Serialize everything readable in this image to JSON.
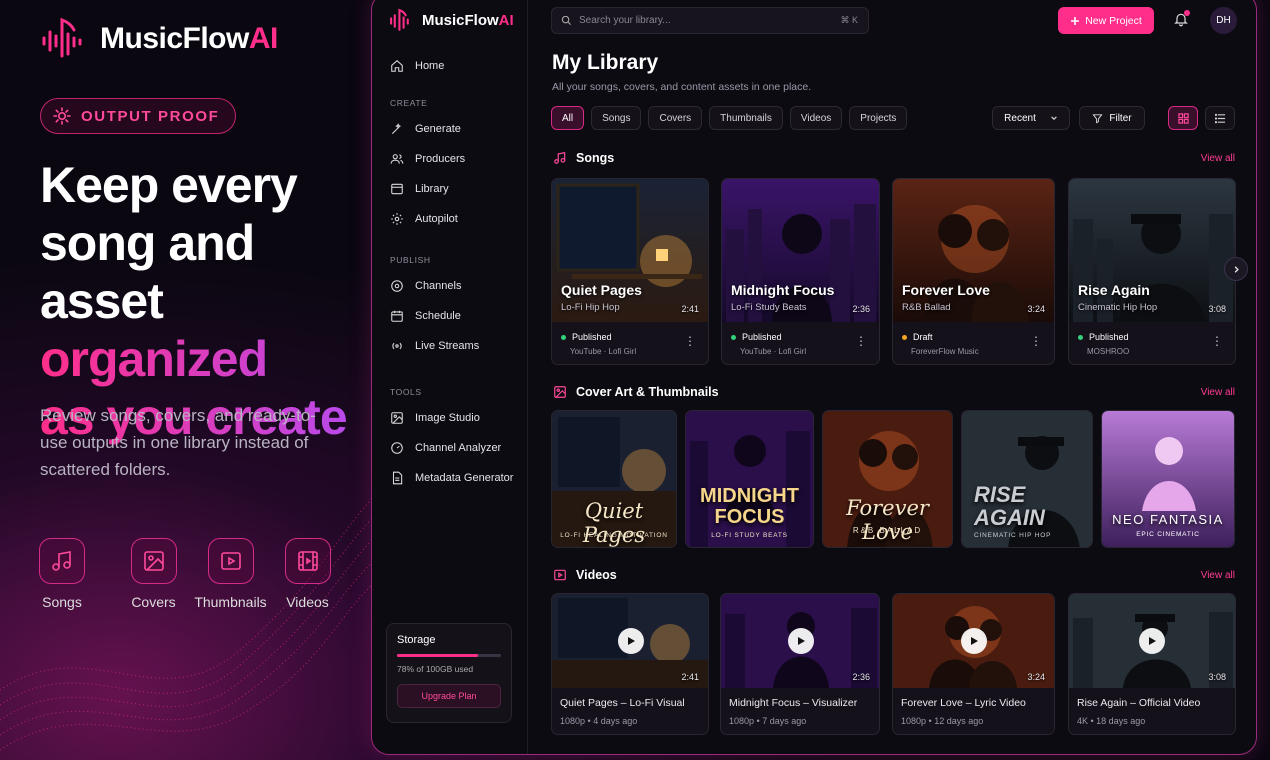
{
  "promo": {
    "brand_main": "MusicFlow",
    "brand_ai": "AI",
    "badge": "OUTPUT PROOF",
    "headline_line1": "Keep every",
    "headline_line2": "song and asset",
    "headline_line3": "organized",
    "headline_line4": "as you create",
    "subtext": "Review songs, covers, and ready-to-use outputs in one library instead of scattered folders.",
    "categories": [
      "Songs",
      "Covers",
      "Thumbnails",
      "Videos"
    ]
  },
  "sidebar": {
    "brand_main": "MusicFlow",
    "brand_ai": "AI",
    "home": "Home",
    "section_create": "CREATE",
    "create_items": [
      "Generate",
      "Producers",
      "Library",
      "Autopilot"
    ],
    "section_publish": "PUBLISH",
    "publish_items": [
      "Channels",
      "Schedule",
      "Live Streams"
    ],
    "section_tools": "TOOLS",
    "tools_items": [
      "Image Studio",
      "Channel Analyzer",
      "Metadata Generator"
    ],
    "storage": {
      "title": "Storage",
      "usage_text": "78% of 100GB used",
      "usage_percent": 78,
      "upgrade": "Upgrade Plan"
    }
  },
  "topbar": {
    "search_placeholder": "Search your library...",
    "search_shortcut": "⌘ K",
    "new_project": "New Project",
    "avatar_initials": "DH"
  },
  "library": {
    "title": "My Library",
    "subtitle": "All your songs, covers, and content assets in one place.",
    "filters": [
      "All",
      "Songs",
      "Covers",
      "Thumbnails",
      "Videos",
      "Projects"
    ],
    "active_filter": "All",
    "sort": "Recent",
    "filter_button": "Filter"
  },
  "songs": {
    "heading": "Songs",
    "view_all": "View all",
    "items": [
      {
        "title": "Quiet Pages",
        "genre": "Lo-Fi Hip Hop",
        "duration": "2:41",
        "status": "Published",
        "platform": "YouTube · Lofi Girl",
        "status_color": "#33d17a"
      },
      {
        "title": "Midnight Focus",
        "genre": "Lo-Fi Study Beats",
        "duration": "2:36",
        "status": "Published",
        "platform": "YouTube · Lofi Girl",
        "status_color": "#33d17a"
      },
      {
        "title": "Forever Love",
        "genre": "R&B Ballad",
        "duration": "3:24",
        "status": "Draft",
        "platform": "ForeverFlow Music",
        "status_color": "#f5a623"
      },
      {
        "title": "Rise Again",
        "genre": "Cinematic Hip Hop",
        "duration": "3:08",
        "status": "Published",
        "platform": "MOSHROO",
        "status_color": "#33d17a"
      }
    ]
  },
  "covers": {
    "heading": "Cover Art & Thumbnails",
    "view_all": "View all",
    "items": [
      {
        "line1": "Quiet Pages",
        "line2": "",
        "tag": "LO-FI HEALING MOTIVATION"
      },
      {
        "line1": "MIDNIGHT",
        "line2": "FOCUS",
        "tag": "LO-FI STUDY BEATS"
      },
      {
        "line1": "Forever Love",
        "line2": "",
        "tag": "R&B BALLAD"
      },
      {
        "line1": "RISE",
        "line2": "AGAIN",
        "tag": "CINEMATIC HIP HOP"
      },
      {
        "line1": "NEO FANTASIA",
        "line2": "",
        "tag": "EPIC CINEMATIC"
      }
    ]
  },
  "videos": {
    "heading": "Videos",
    "view_all": "View all",
    "items": [
      {
        "title": "Quiet Pages – Lo-Fi Visual",
        "duration": "2:41",
        "quality": "1080p",
        "age": "4 days ago"
      },
      {
        "title": "Midnight Focus – Visualizer",
        "duration": "2:36",
        "quality": "1080p",
        "age": "7 days ago"
      },
      {
        "title": "Forever Love – Lyric Video",
        "duration": "3:24",
        "quality": "1080p",
        "age": "12 days ago"
      },
      {
        "title": "Rise Again – Official Video",
        "duration": "3:08",
        "quality": "4K",
        "age": "18 days ago"
      }
    ]
  },
  "colors": {
    "accent": "#ff2e8a",
    "accent_purple": "#b44cf2",
    "background": "#0a0710",
    "panel": "#0d0b12"
  }
}
